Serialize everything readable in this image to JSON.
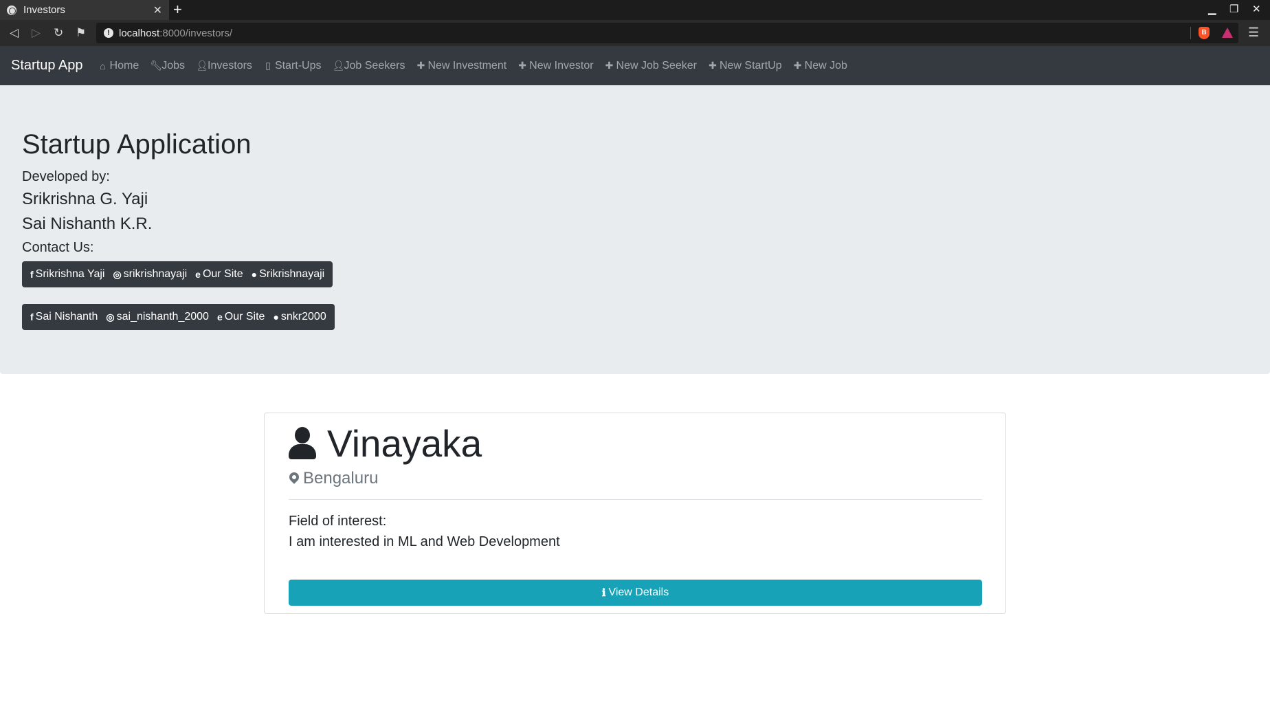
{
  "browser": {
    "tab_title": "Investors",
    "new_tab": "+",
    "url_host": "localhost",
    "url_path": ":8000/investors/"
  },
  "navbar": {
    "brand": "Startup App",
    "links": [
      {
        "label": "Home",
        "icon": "home-icon"
      },
      {
        "label": "Jobs",
        "icon": "wrench-icon"
      },
      {
        "label": "Investors",
        "icon": "user-icon"
      },
      {
        "label": "Start-Ups",
        "icon": "building-icon"
      },
      {
        "label": "Job Seekers",
        "icon": "user-icon"
      },
      {
        "label": "New Investment",
        "icon": "plus-icon"
      },
      {
        "label": "New Investor",
        "icon": "plus-icon"
      },
      {
        "label": "New Job Seeker",
        "icon": "plus-icon"
      },
      {
        "label": "New StartUp",
        "icon": "plus-icon"
      },
      {
        "label": "New Job",
        "icon": "plus-icon"
      }
    ]
  },
  "jumbotron": {
    "title": "Startup Application",
    "developed_by": "Developed by:",
    "developers": [
      "Srikrishna G. Yaji",
      "Sai Nishanth K.R."
    ],
    "contact_label": "Contact Us:",
    "contacts_1": [
      {
        "label": "Srikrishna Yaji",
        "icon": "facebook-icon"
      },
      {
        "label": "srikrishnayaji",
        "icon": "instagram-icon"
      },
      {
        "label": "Our Site",
        "icon": "internet-explorer-icon"
      },
      {
        "label": "Srikrishnayaji",
        "icon": "github-icon"
      }
    ],
    "contacts_2": [
      {
        "label": "Sai Nishanth",
        "icon": "facebook-icon"
      },
      {
        "label": "sai_nishanth_2000",
        "icon": "instagram-icon"
      },
      {
        "label": "Our Site",
        "icon": "internet-explorer-icon"
      },
      {
        "label": "snkr2000",
        "icon": "github-icon"
      }
    ]
  },
  "investor_card": {
    "name": "Vinayaka",
    "location": "Bengaluru",
    "interest_label": "Field of interest:",
    "interest_value": "I am interested in ML and Web Development",
    "button_label": "View Details"
  },
  "colors": {
    "navbar_bg": "#343a40",
    "jumbotron_bg": "#e9ecef",
    "info_button": "#17a2b8",
    "muted_text": "#6c757d"
  }
}
